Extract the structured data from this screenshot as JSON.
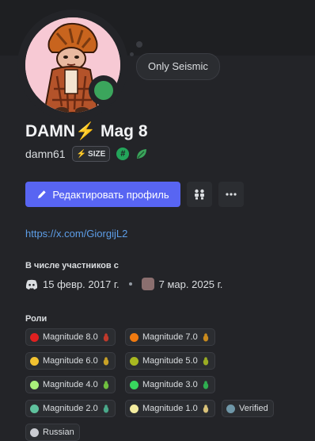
{
  "status": {
    "text": "Only Seismic",
    "color": "#3ba55c"
  },
  "profile": {
    "display_name": "DAMN",
    "display_emoji": "⚡",
    "display_suffix": "Mag 8",
    "username": "damn61",
    "tag": {
      "emoji": "⚡",
      "label": "SIZE"
    },
    "badges": [
      {
        "icon": "hash-badge-icon"
      },
      {
        "icon": "leaf-badge-icon"
      }
    ]
  },
  "actions": {
    "edit_label": "Редактировать профиль",
    "edit_icon": "pencil-icon",
    "second_icon": "people-icon",
    "more_icon": "more-dots-icon",
    "accent": "#5865f2"
  },
  "link": "https://x.com/GiorgijL2",
  "member_since": {
    "title": "В числе участников с",
    "discord_date": "15 февр. 2017 г.",
    "server_date": "7 мар. 2025 г."
  },
  "roles": {
    "title": "Роли",
    "items": [
      {
        "label": "Magnitude 8.0",
        "color": "#e02020",
        "icon_color": "#c0392b"
      },
      {
        "label": "Magnitude 7.0",
        "color": "#f07a10",
        "icon_color": "#c98a1d"
      },
      {
        "label": "Magnitude 6.0",
        "color": "#f2c230",
        "icon_color": "#c9a227"
      },
      {
        "label": "Magnitude 5.0",
        "color": "#a8b820",
        "icon_color": "#9aad23"
      },
      {
        "label": "Magnitude 4.0",
        "color": "#a9f07a",
        "icon_color": "#6fbf3f"
      },
      {
        "label": "Magnitude 3.0",
        "color": "#38d85e",
        "icon_color": "#2fae50"
      },
      {
        "label": "Magnitude 2.0",
        "color": "#5fc29e",
        "icon_color": "#4aa88a"
      },
      {
        "label": "Magnitude 1.0",
        "color": "#f4eda0",
        "icon_color": "#d9c27a"
      },
      {
        "label": "Verified",
        "color": "#6f97a8",
        "icon_color": ""
      },
      {
        "label": "Russian",
        "color": "#c9cbd0",
        "icon_color": ""
      }
    ]
  }
}
